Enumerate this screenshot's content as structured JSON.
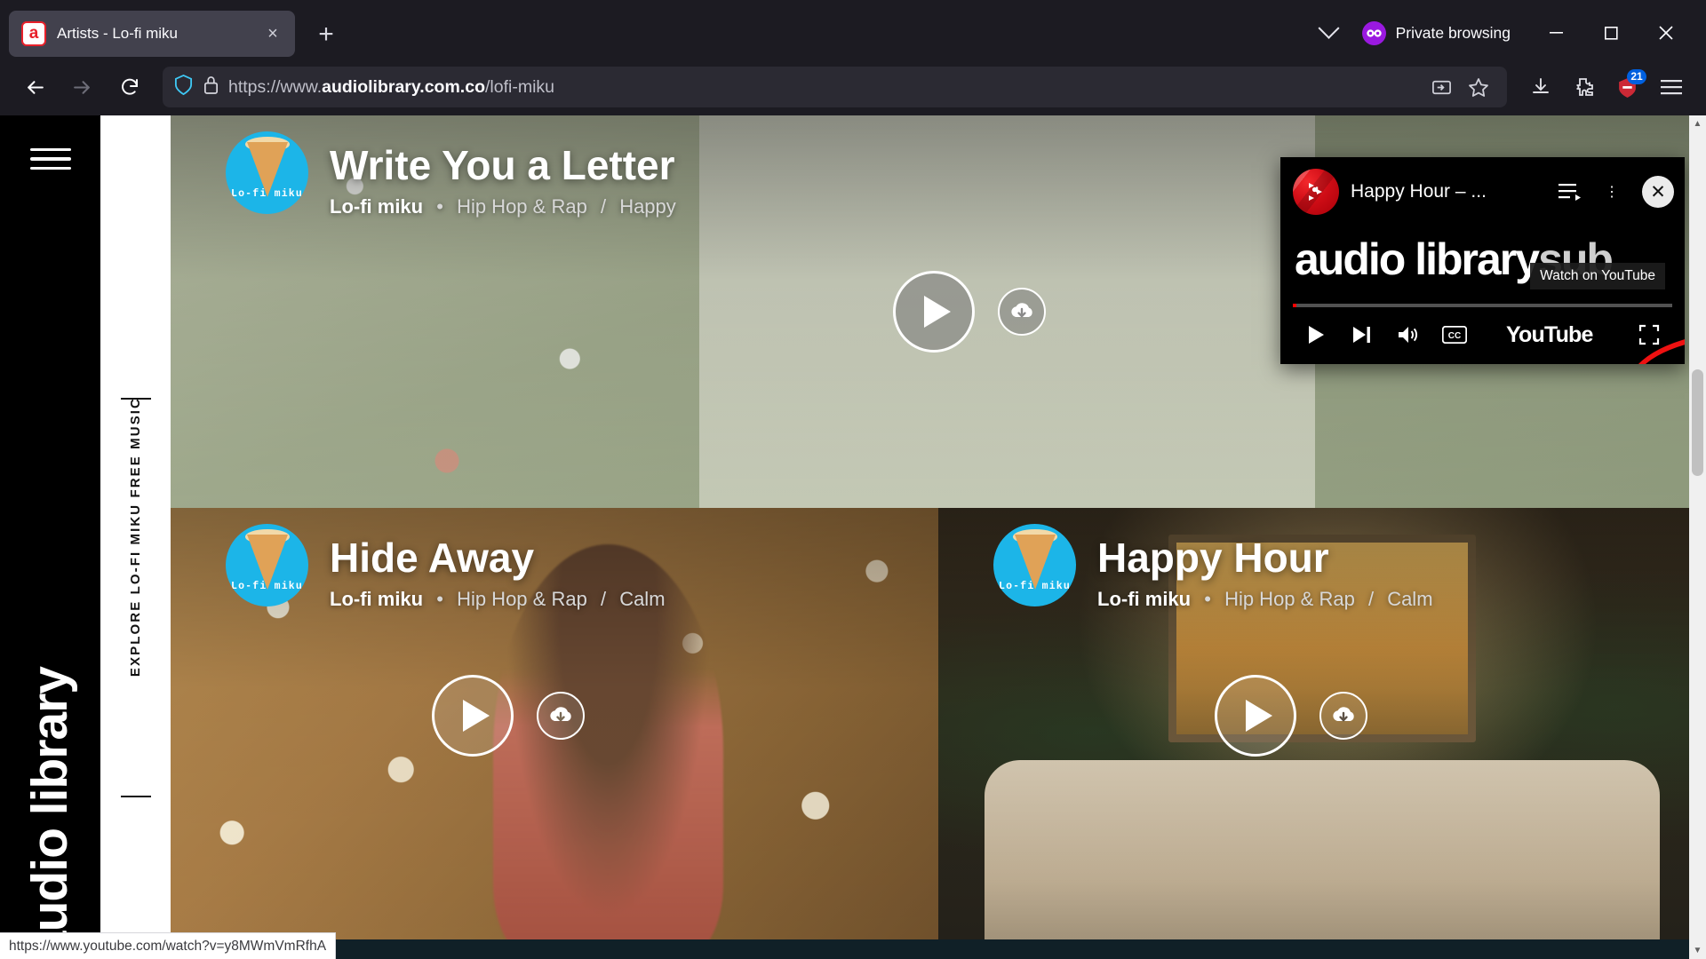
{
  "browser": {
    "tab": {
      "title": "Artists - Lo-fi miku",
      "favicon_letter": "a",
      "close_icon": "×"
    },
    "new_tab_icon": "+",
    "chevron_icon": "chevron-down",
    "private_label": "Private browsing",
    "window_controls": {
      "minimize": "—",
      "maximize": "▢",
      "close": "✕"
    },
    "nav": {
      "back_icon": "←",
      "forward_icon": "→",
      "reload_icon": "⟳"
    },
    "url": {
      "scheme": "https://www.",
      "domain": "audiolibrary.com.co",
      "path": "/lofi-miku"
    },
    "extension_badge": "21",
    "status_url": "https://www.youtube.com/watch?v=y8MWmVmRfhA"
  },
  "page": {
    "brand_wordmark": "audio library",
    "rail_label": "EXPLORE LO-FI MIKU FREE MUSIC",
    "cards": [
      {
        "title": "Write You a Letter",
        "artist": "Lo-fi miku",
        "genre": "Hip Hop & Rap",
        "mood": "Happy",
        "separator": "•",
        "mood_separator": "/",
        "avatar_label": "Lo-fi miku"
      },
      {
        "title": "Hide Away",
        "artist": "Lo-fi miku",
        "genre": "Hip Hop & Rap",
        "mood": "Calm",
        "separator": "•",
        "mood_separator": "/",
        "avatar_label": "Lo-fi miku"
      },
      {
        "title": "Happy Hour",
        "artist": "Lo-fi miku",
        "genre": "Hip Hop & Rap",
        "mood": "Calm",
        "separator": "•",
        "mood_separator": "/",
        "avatar_label": "Lo-fi miku"
      }
    ]
  },
  "yt_player": {
    "video_title": "Happy Hour – ...",
    "wordmark_main": "audio library",
    "wordmark_dim": "sub",
    "tooltip": "Watch on YouTube",
    "close_icon": "✕",
    "queue_icon": "playlist-icon",
    "more_icon": "⋮",
    "controls": {
      "play": "▶",
      "next": "⏭",
      "volume": "🔊",
      "captions": "CC",
      "youtube_label": "YouTube",
      "fullscreen": "⛶"
    },
    "annotation_color": "#ee1111",
    "progress_percent": 1
  },
  "colors": {
    "chrome_bg": "#1c1b22",
    "tab_bg": "#42414d",
    "urlbar_bg": "#2b2a33",
    "private_purple": "#9a19e0",
    "avatar_cyan": "#1cb5e8",
    "badge_blue": "#0060df"
  }
}
